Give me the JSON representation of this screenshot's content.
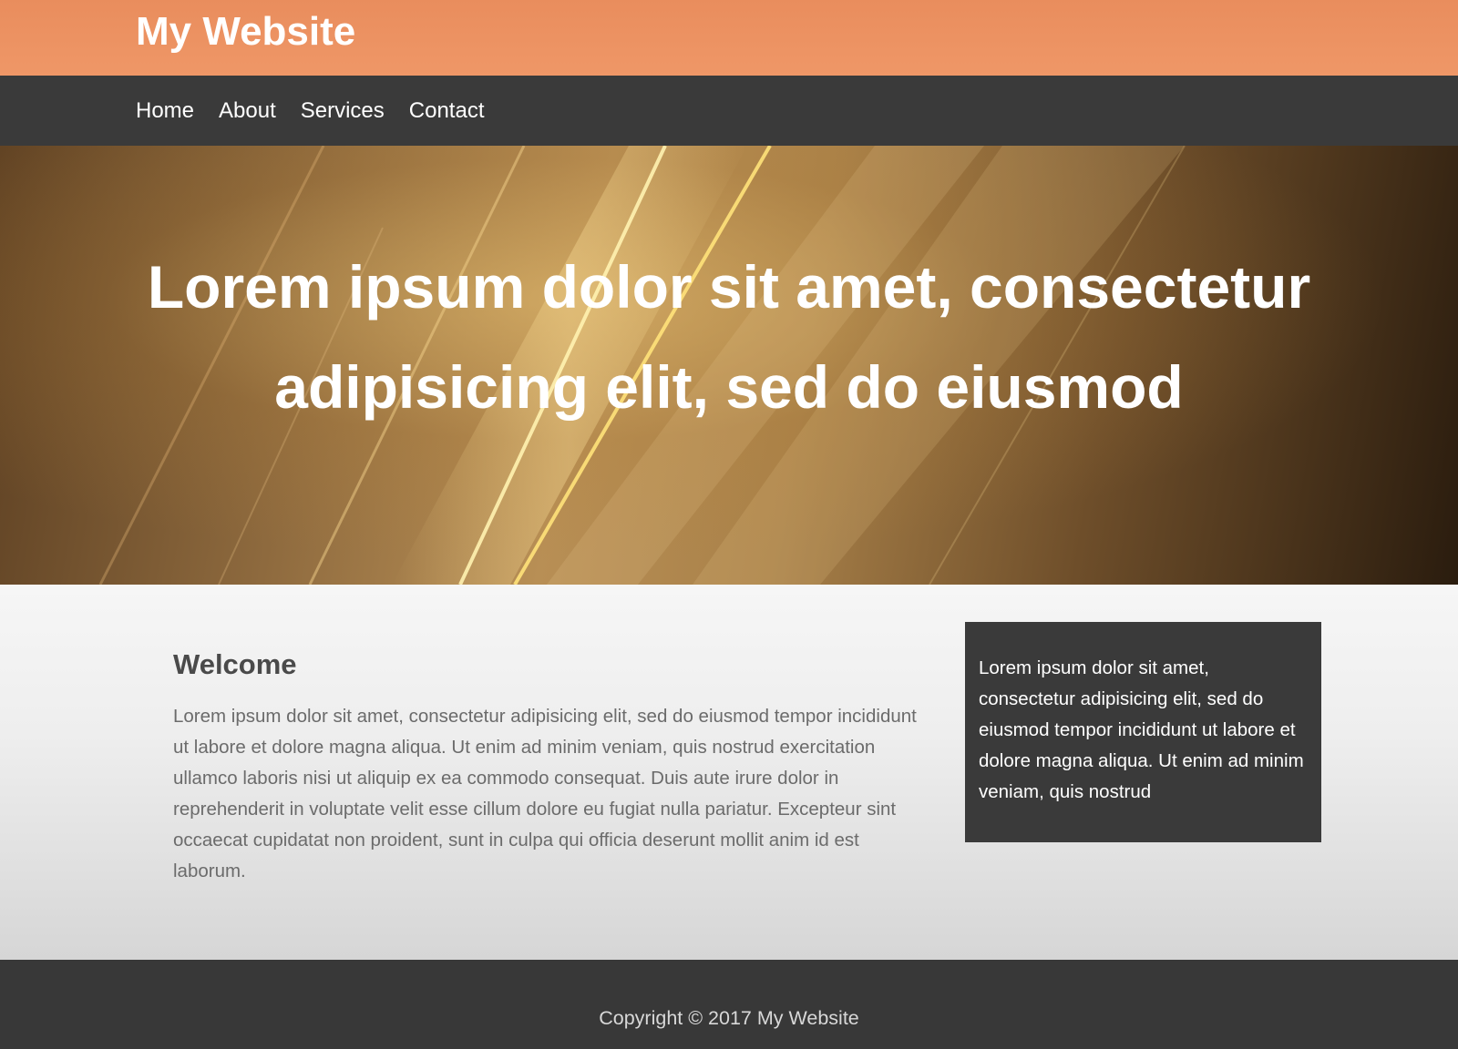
{
  "header": {
    "site_title": "My Website"
  },
  "nav": {
    "items": [
      {
        "label": "Home"
      },
      {
        "label": "About"
      },
      {
        "label": "Services"
      },
      {
        "label": "Contact"
      }
    ]
  },
  "hero": {
    "headline": "Lorem ipsum dolor sit amet, consectetur adipisicing elit, sed do eiusmod"
  },
  "main": {
    "welcome_title": "Welcome",
    "welcome_body": "Lorem ipsum dolor sit amet, consectetur adipisicing elit, sed do eiusmod tempor incididunt ut labore et dolore magna aliqua. Ut enim ad minim veniam, quis nostrud exercitation ullamco laboris nisi ut aliquip ex ea commodo consequat. Duis aute irure dolor in reprehenderit in voluptate velit esse cillum dolore eu fugiat nulla pariatur. Excepteur sint occaecat cupidatat non proident, sunt in culpa qui officia deserunt mollit anim id est laborum.",
    "sidebar_text": "Lorem ipsum dolor sit amet, consectetur adipisicing elit, sed do eiusmod tempor incididunt ut labore et dolore magna aliqua. Ut enim ad minim veniam, quis nostrud"
  },
  "footer": {
    "copyright": "Copyright © 2017 My Website"
  },
  "colors": {
    "header_bg": "#ec9262",
    "nav_bg": "#3a3a3a",
    "sidebar_bg": "#3a3a3a",
    "footer_bg": "#383838"
  }
}
